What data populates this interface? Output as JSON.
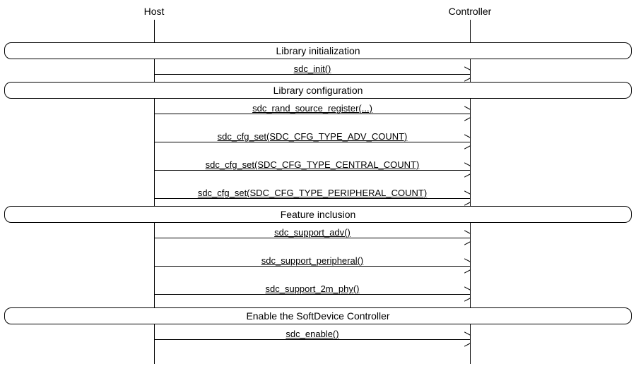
{
  "participants": {
    "host": "Host",
    "controller": "Controller"
  },
  "sections": [
    {
      "title": "Library initialization"
    },
    {
      "title": "Library configuration"
    },
    {
      "title": "Feature inclusion"
    },
    {
      "title": "Enable the SoftDevice Controller"
    }
  ],
  "messages": {
    "m1": "sdc_init()",
    "m2": "sdc_rand_source_register(...)",
    "m3": "sdc_cfg_set(SDC_CFG_TYPE_ADV_COUNT)",
    "m4": "sdc_cfg_set(SDC_CFG_TYPE_CENTRAL_COUNT)",
    "m5": "sdc_cfg_set(SDC_CFG_TYPE_PERIPHERAL_COUNT)",
    "m6": "sdc_support_adv()",
    "m7": "sdc_support_peripheral()",
    "m8": "sdc_support_2m_phy()",
    "m9": "sdc_enable()"
  },
  "chart_data": {
    "type": "sequence",
    "participants": [
      "Host",
      "Controller"
    ],
    "events": [
      {
        "kind": "section",
        "title": "Library initialization"
      },
      {
        "kind": "message",
        "from": "Host",
        "to": "Controller",
        "label": "sdc_init()"
      },
      {
        "kind": "section",
        "title": "Library configuration"
      },
      {
        "kind": "message",
        "from": "Host",
        "to": "Controller",
        "label": "sdc_rand_source_register(...)"
      },
      {
        "kind": "message",
        "from": "Host",
        "to": "Controller",
        "label": "sdc_cfg_set(SDC_CFG_TYPE_ADV_COUNT)"
      },
      {
        "kind": "message",
        "from": "Host",
        "to": "Controller",
        "label": "sdc_cfg_set(SDC_CFG_TYPE_CENTRAL_COUNT)"
      },
      {
        "kind": "message",
        "from": "Host",
        "to": "Controller",
        "label": "sdc_cfg_set(SDC_CFG_TYPE_PERIPHERAL_COUNT)"
      },
      {
        "kind": "section",
        "title": "Feature inclusion"
      },
      {
        "kind": "message",
        "from": "Host",
        "to": "Controller",
        "label": "sdc_support_adv()"
      },
      {
        "kind": "message",
        "from": "Host",
        "to": "Controller",
        "label": "sdc_support_peripheral()"
      },
      {
        "kind": "message",
        "from": "Host",
        "to": "Controller",
        "label": "sdc_support_2m_phy()"
      },
      {
        "kind": "section",
        "title": "Enable the SoftDevice Controller"
      },
      {
        "kind": "message",
        "from": "Host",
        "to": "Controller",
        "label": "sdc_enable()"
      }
    ]
  }
}
